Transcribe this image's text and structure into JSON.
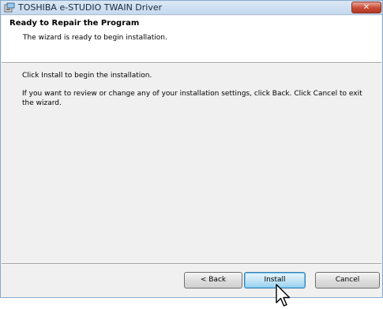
{
  "window": {
    "title": "TOSHIBA e-STUDIO TWAIN Driver",
    "close_label": "✕"
  },
  "header": {
    "title": "Ready to Repair the Program",
    "subtitle": "The wizard is ready to begin installation."
  },
  "content": {
    "line1": "Click Install to begin the installation.",
    "line2": "If you want to review or change any of your installation settings, click Back. Click Cancel to exit the wizard."
  },
  "buttons": {
    "back": "< Back",
    "install": "Install",
    "cancel": "Cancel"
  },
  "colors": {
    "accent": "#3c7fb1",
    "close": "#c74a34"
  },
  "icons": {
    "title": "installer-icon",
    "close": "close-icon",
    "cursor": "pointer-cursor-icon"
  }
}
